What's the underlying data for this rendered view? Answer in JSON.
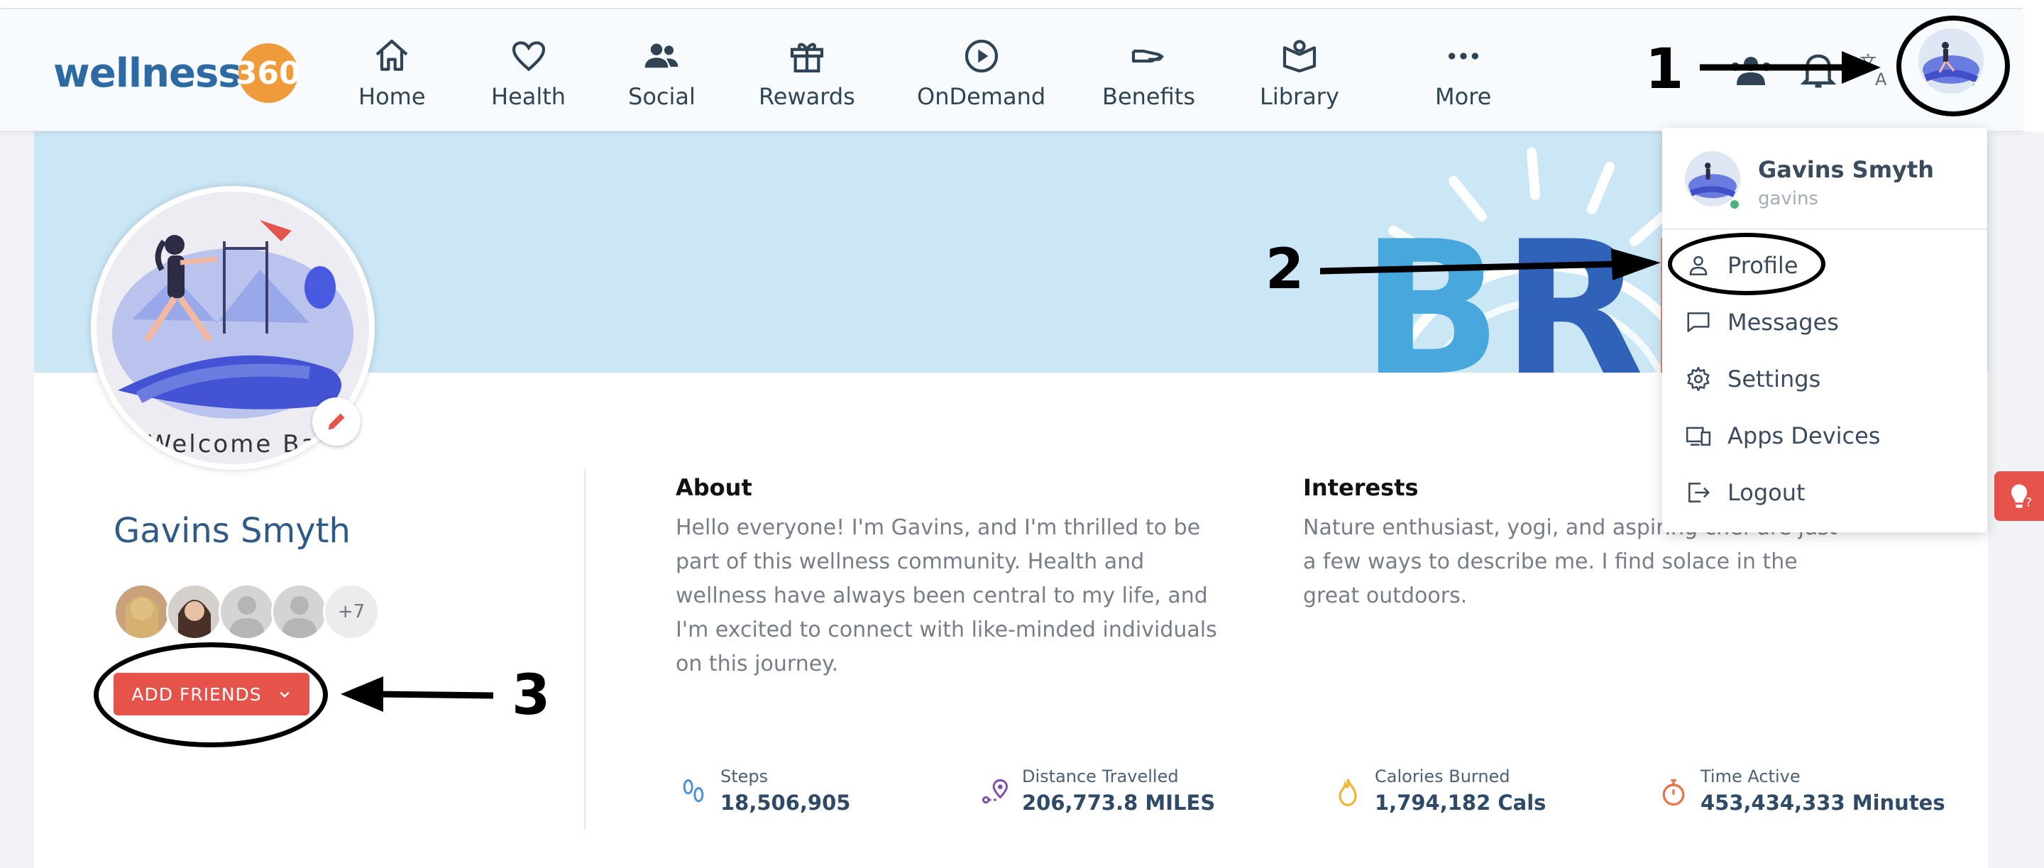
{
  "brand": {
    "name": "wellness",
    "suffix": "360"
  },
  "nav": {
    "items": [
      {
        "label": "Home",
        "icon": "home-icon"
      },
      {
        "label": "Health",
        "icon": "heart-icon"
      },
      {
        "label": "Social",
        "icon": "people-icon"
      },
      {
        "label": "Rewards",
        "icon": "gift-icon"
      },
      {
        "label": "OnDemand",
        "icon": "play-icon"
      },
      {
        "label": "Benefits",
        "icon": "hand-icon"
      },
      {
        "label": "Library",
        "icon": "book-icon"
      },
      {
        "label": "More",
        "icon": "more-icon"
      }
    ]
  },
  "annotations": {
    "one": "1",
    "two": "2",
    "three": "3"
  },
  "user_menu": {
    "name": "Gavins Smyth",
    "username": "gavins",
    "items": [
      {
        "label": "Profile",
        "icon": "person-icon"
      },
      {
        "label": "Messages",
        "icon": "message-icon"
      },
      {
        "label": "Settings",
        "icon": "gear-icon"
      },
      {
        "label": "Apps Devices",
        "icon": "devices-icon"
      },
      {
        "label": "Logout",
        "icon": "logout-icon"
      }
    ]
  },
  "profile": {
    "photo_caption": "Welcome Ba",
    "name": "Gavins Smyth",
    "friends_more": "+7",
    "add_friends_label": "ADD FRIENDS"
  },
  "about": {
    "heading": "About",
    "text": "Hello everyone! I'm Gavins, and I'm thrilled to be part of this wellness community. Health and wellness have always been central to my life, and I'm excited to connect with like-minded individuals on this journey."
  },
  "interests": {
    "heading": "Interests",
    "text": "Nature enthusiast, yogi, and aspiring chef are just a few ways to describe me. I find solace in the great outdoors."
  },
  "stats": [
    {
      "label": "Steps",
      "value": "18,506,905",
      "icon": "footsteps-icon"
    },
    {
      "label": "Distance Travelled",
      "value": "206,773.8 MILES",
      "icon": "route-icon"
    },
    {
      "label": "Calories Burned",
      "value": "1,794,182 Cals",
      "icon": "flame-icon"
    },
    {
      "label": "Time Active",
      "value": "453,434,333 Minutes",
      "icon": "stopwatch-icon"
    }
  ],
  "banner": {
    "word": "BREA"
  },
  "colors": {
    "accent": "#e5534b",
    "brand_blue": "#2d6aa3",
    "brand_orange": "#ef9a3b",
    "banner": "#cbe7f6"
  }
}
